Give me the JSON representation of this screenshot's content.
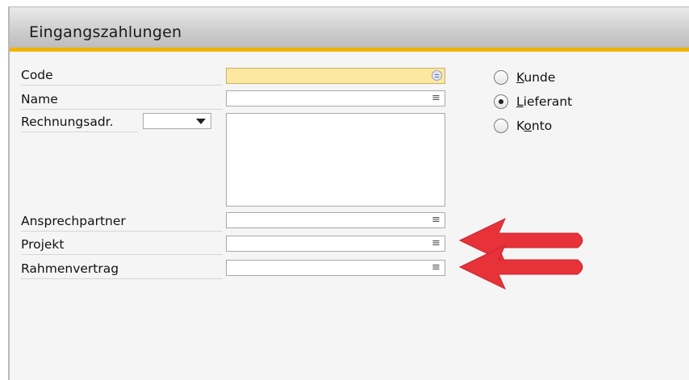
{
  "window": {
    "title": "Eingangszahlungen"
  },
  "form": {
    "code_label": "Code",
    "code_value": "",
    "name_label": "Name",
    "name_value": "",
    "billing_address_label": "Rechnungsadr.",
    "billing_address_select_value": "",
    "billing_address_text": "",
    "contact_person_label": "Ansprechpartner",
    "contact_person_value": "",
    "project_label": "Projekt",
    "project_value": "",
    "framework_contract_label": "Rahmenvertrag",
    "framework_contract_value": ""
  },
  "partner_type": {
    "options": [
      {
        "label_mnemonic": "K",
        "label_rest": "unde",
        "checked": false
      },
      {
        "label_mnemonic": "L",
        "label_rest": "ieferant",
        "checked": true
      },
      {
        "label_pre": "K",
        "label_mnemonic": "o",
        "label_rest": "nto",
        "checked": false
      }
    ]
  },
  "icons": {
    "field_menu": "list-menu-icon",
    "code_lookup": "lookup-circle-icon",
    "dropdown": "chevron-down-icon",
    "annotation": "red-arrow-icon"
  },
  "colors": {
    "accent_bar": "#f0b400",
    "code_field_bg": "#fce8a0",
    "annotation_arrow": "#e8323a"
  }
}
